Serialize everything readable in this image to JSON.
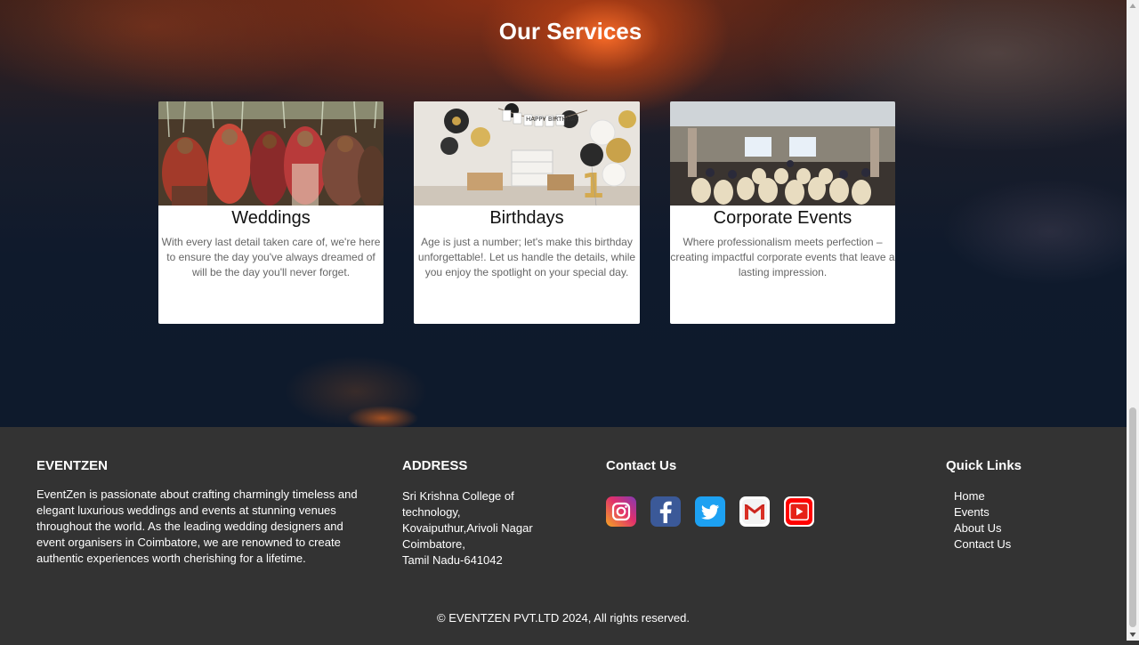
{
  "services": {
    "title": "Our Services",
    "cards": [
      {
        "title": "Weddings",
        "text": "With every last detail taken care of, we're here to ensure the day you've always dreamed of will be the day you'll never forget."
      },
      {
        "title": "Birthdays",
        "text": "Age is just a number; let's make this birthday unforgettable!. Let us handle the details, while you enjoy the spotlight on your special day."
      },
      {
        "title": "Corporate Events",
        "text": "Where professionalism meets perfection – creating impactful corporate events that leave a lasting impression."
      }
    ],
    "birthday_banner": "HAPPY BIRTHDAY",
    "birthday_number": "1"
  },
  "footer": {
    "brand": {
      "heading": "EVENTZEN",
      "text": "EventZen is passionate about crafting charmingly timeless and elegant luxurious weddings and events at stunning venues throughout the world. As the leading wedding designers and event organisers in Coimbatore, we are renowned to create authentic experiences worth cherishing for a lifetime."
    },
    "address": {
      "heading": "ADDRESS",
      "lines": [
        "Sri Krishna College of",
        "technology,",
        "Kovaiputhur,Arivoli Nagar",
        "Coimbatore,",
        "Tamil Nadu-641042"
      ]
    },
    "contact": {
      "heading": "Contact Us",
      "icons": [
        "instagram-icon",
        "facebook-icon",
        "twitter-icon",
        "gmail-icon",
        "youtube-icon"
      ]
    },
    "quick_links": {
      "heading": "Quick Links",
      "items": [
        "Home",
        "Events",
        "About Us",
        "Contact Us"
      ]
    },
    "copyright": "© EVENTZEN PVT.LTD 2024, All rights reserved."
  },
  "colors": {
    "footer_bg": "#333333",
    "instagram": "#c13584",
    "facebook": "#3b5998",
    "twitter": "#1da1f2",
    "gmail": "#d93025",
    "youtube": "#ff0000"
  }
}
